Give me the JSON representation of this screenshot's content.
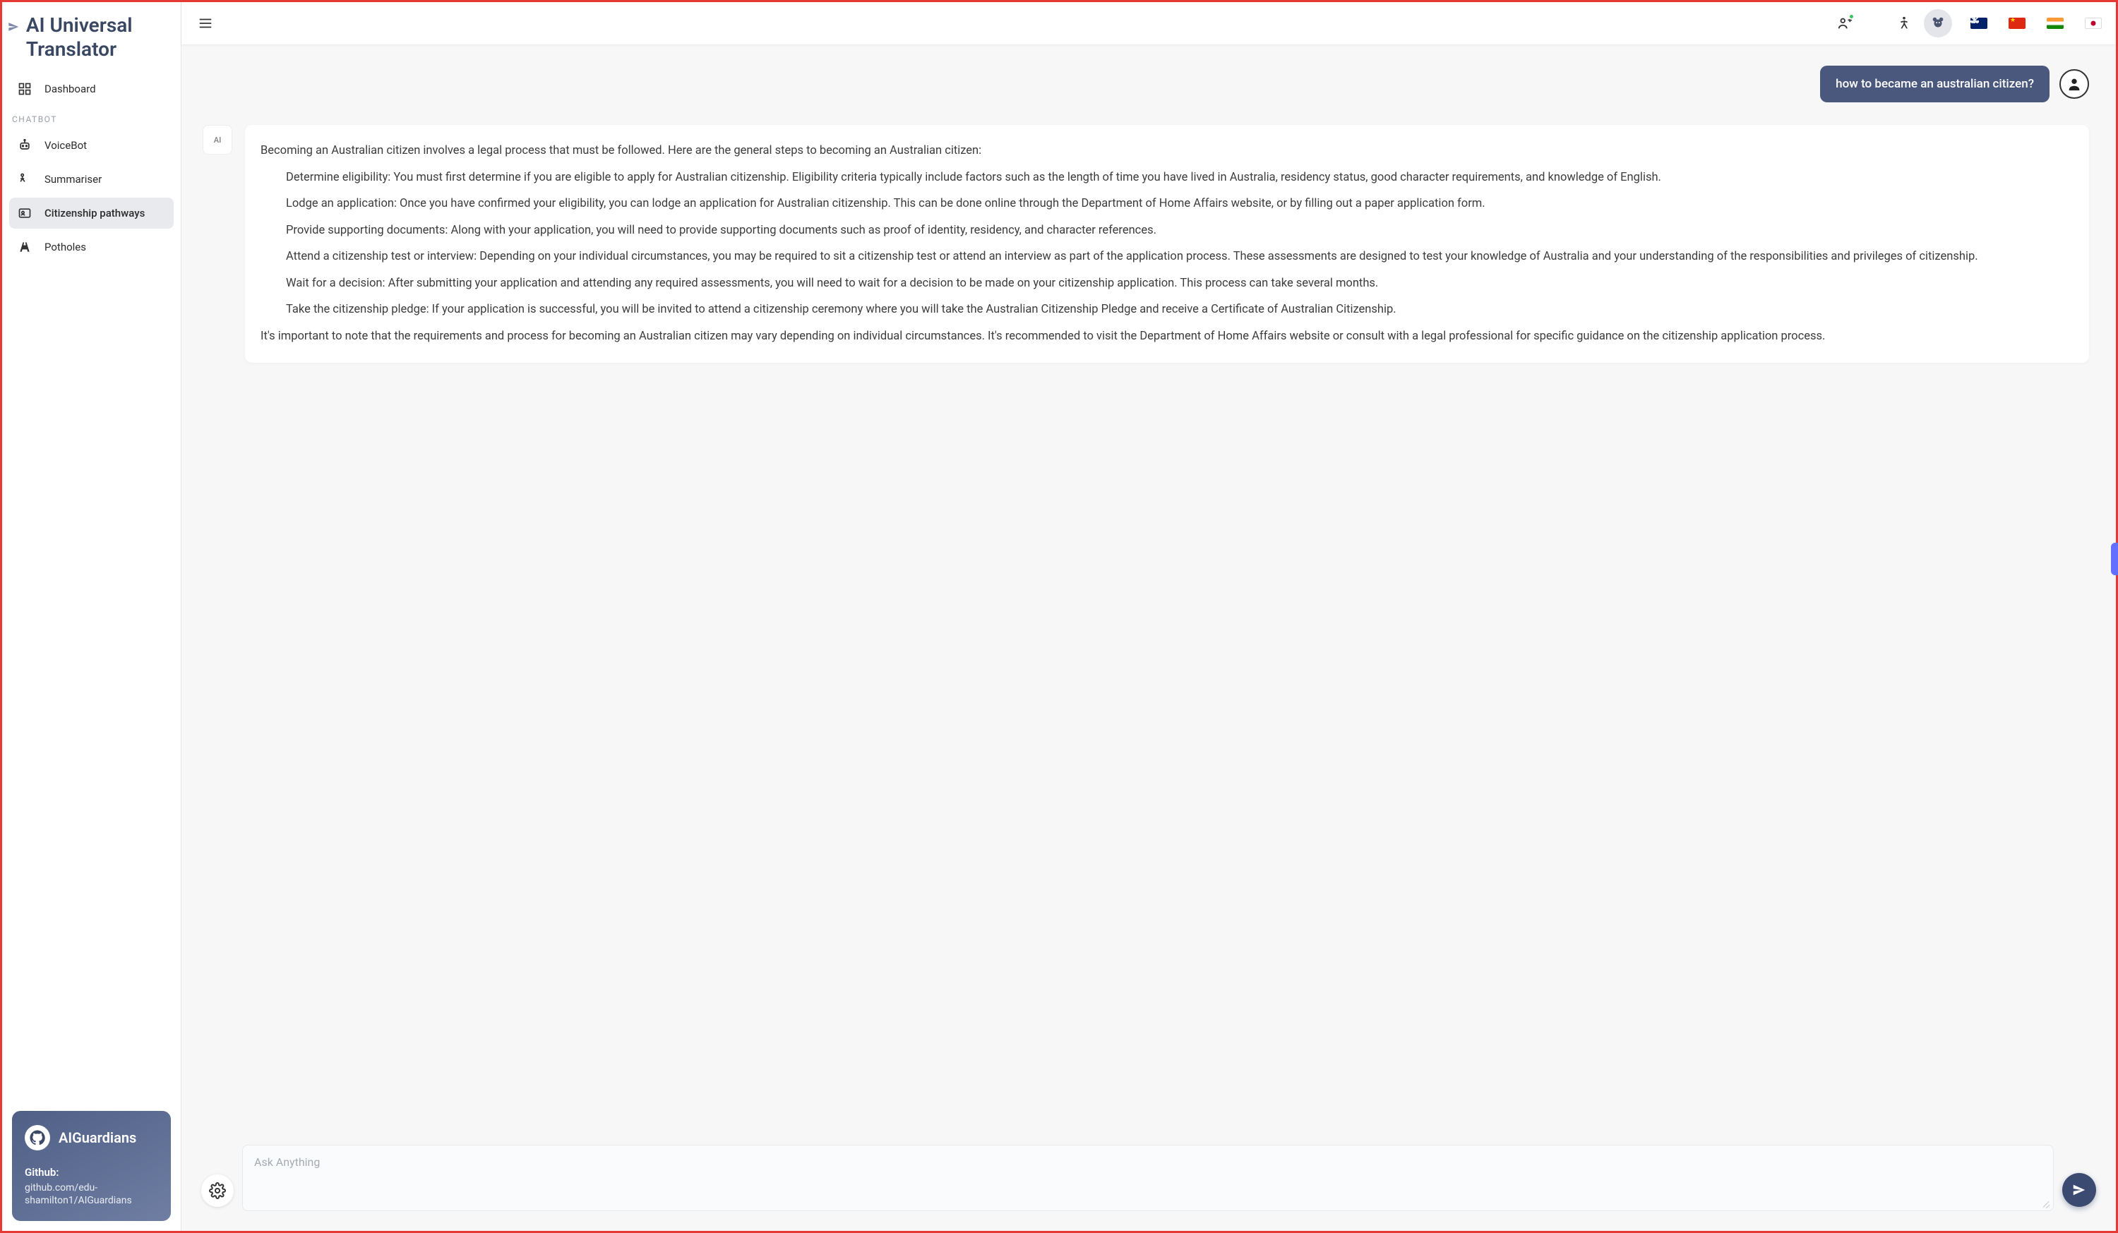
{
  "brand": {
    "title": "AI Universal Translator"
  },
  "sidebar": {
    "dashboard_label": "Dashboard",
    "section_label": "CHATBOT",
    "items": [
      {
        "label": "VoiceBot"
      },
      {
        "label": "Summariser"
      },
      {
        "label": "Citizenship pathways"
      },
      {
        "label": "Potholes"
      }
    ],
    "active_index": 2
  },
  "footer_card": {
    "title": "AIGuardians",
    "github_label": "Github:",
    "github_url_line1": "github.com/edu-",
    "github_url_line2": "shamilton1/AIGuardians"
  },
  "topbar": {
    "flags": [
      "au",
      "cn",
      "in",
      "jp"
    ]
  },
  "chat": {
    "user_message": "how to became an australian citizen?",
    "bot_avatar_label": "AI",
    "bot_intro": "Becoming an Australian citizen involves a legal process that must be followed. Here are the general steps to becoming an Australian citizen:",
    "bot_steps": [
      "Determine eligibility: You must first determine if you are eligible to apply for Australian citizenship. Eligibility criteria typically include factors such as the length of time you have lived in Australia, residency status, good character requirements, and knowledge of English.",
      "Lodge an application: Once you have confirmed your eligibility, you can lodge an application for Australian citizenship. This can be done online through the Department of Home Affairs website, or by filling out a paper application form.",
      "Provide supporting documents: Along with your application, you will need to provide supporting documents such as proof of identity, residency, and character references.",
      "Attend a citizenship test or interview: Depending on your individual circumstances, you may be required to sit a citizenship test or attend an interview as part of the application process. These assessments are designed to test your knowledge of Australia and your understanding of the responsibilities and privileges of citizenship.",
      "Wait for a decision: After submitting your application and attending any required assessments, you will need to wait for a decision to be made on your citizenship application. This process can take several months.",
      "Take the citizenship pledge: If your application is successful, you will be invited to attend a citizenship ceremony where you will take the Australian Citizenship Pledge and receive a Certificate of Australian Citizenship."
    ],
    "bot_outro": "It's important to note that the requirements and process for becoming an Australian citizen may vary depending on individual circumstances. It's recommended to visit the Department of Home Affairs website or consult with a legal professional for specific guidance on the citizenship application process."
  },
  "composer": {
    "placeholder": "Ask Anything"
  }
}
